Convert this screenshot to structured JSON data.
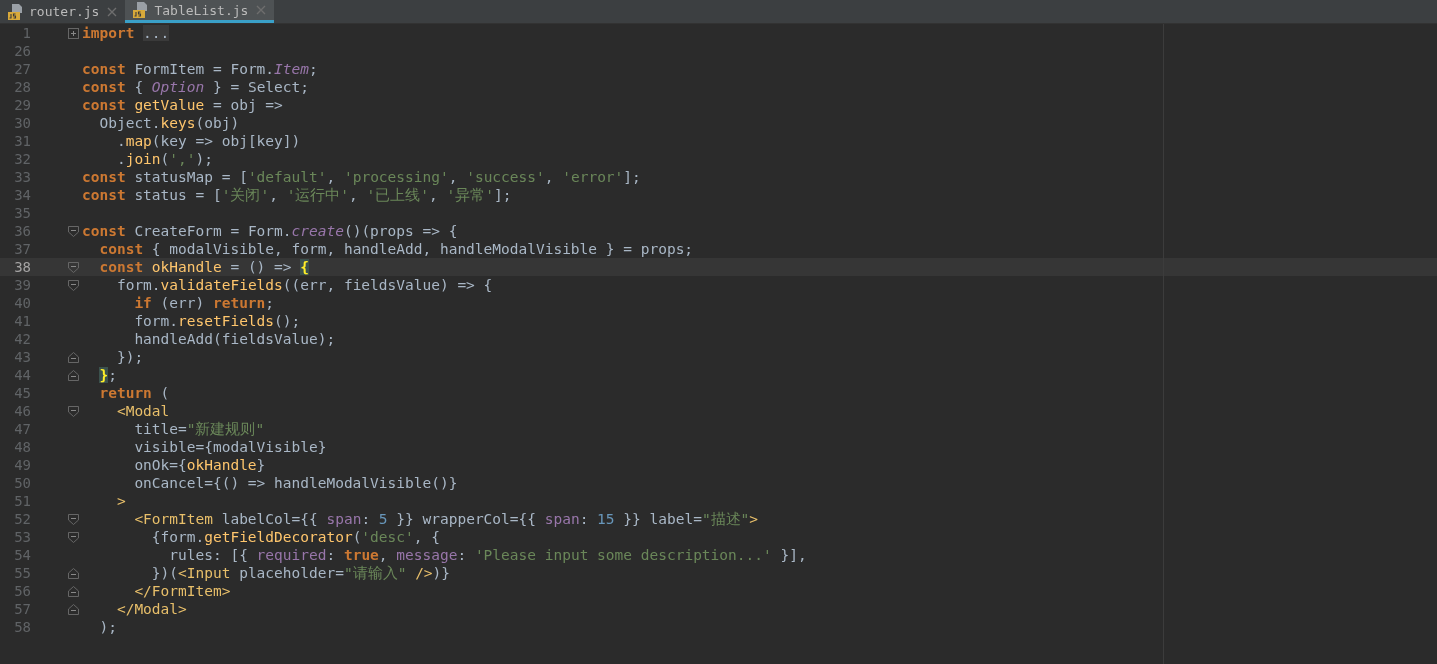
{
  "tabs": [
    {
      "label": "router.js",
      "selected": false
    },
    {
      "label": "TableList.js",
      "selected": true
    }
  ],
  "lines": [
    {
      "number": "1",
      "current": false,
      "kind": "collapsed",
      "tokens": [
        {
          "kind": "keyword",
          "text": "import "
        },
        {
          "kind": "folded",
          "text": "..."
        }
      ]
    },
    {
      "number": "26",
      "current": false,
      "kind": "plain"
    },
    {
      "number": "27",
      "current": false,
      "kind": "plain",
      "tokens": [
        {
          "kind": "keyword",
          "text": "const "
        },
        {
          "kind": "plain",
          "text": "FormItem = Form."
        },
        {
          "kind": "member",
          "text": "Item"
        },
        {
          "kind": "plain",
          "text": ";"
        }
      ]
    },
    {
      "number": "28",
      "current": false,
      "kind": "plain",
      "tokens": [
        {
          "kind": "keyword",
          "text": "const "
        },
        {
          "kind": "plain",
          "text": "{ "
        },
        {
          "kind": "member",
          "text": "Option"
        },
        {
          "kind": "plain",
          "text": " } = Select;"
        }
      ]
    },
    {
      "number": "29",
      "current": false,
      "kind": "plain",
      "tokens": [
        {
          "kind": "keyword",
          "text": "const "
        },
        {
          "kind": "function",
          "text": "getValue"
        },
        {
          "kind": "plain",
          "text": " = obj =>"
        }
      ]
    },
    {
      "number": "30",
      "current": false,
      "kind": "plain",
      "tokens": [
        {
          "kind": "plain",
          "text": "  Object."
        },
        {
          "kind": "function",
          "text": "keys"
        },
        {
          "kind": "plain",
          "text": "(obj)"
        }
      ]
    },
    {
      "number": "31",
      "current": false,
      "kind": "plain",
      "tokens": [
        {
          "kind": "plain",
          "text": "    ."
        },
        {
          "kind": "function",
          "text": "map"
        },
        {
          "kind": "plain",
          "text": "(key => obj[key])"
        }
      ]
    },
    {
      "number": "32",
      "current": false,
      "kind": "plain",
      "tokens": [
        {
          "kind": "plain",
          "text": "    ."
        },
        {
          "kind": "function",
          "text": "join"
        },
        {
          "kind": "plain",
          "text": "("
        },
        {
          "kind": "string",
          "text": "','"
        },
        {
          "kind": "plain",
          "text": ");"
        }
      ]
    },
    {
      "number": "33",
      "current": false,
      "kind": "plain",
      "tokens": [
        {
          "kind": "keyword",
          "text": "const "
        },
        {
          "kind": "plain",
          "text": "statusMap = ["
        },
        {
          "kind": "string",
          "text": "'default'"
        },
        {
          "kind": "plain",
          "text": ", "
        },
        {
          "kind": "string",
          "text": "'processing'"
        },
        {
          "kind": "plain",
          "text": ", "
        },
        {
          "kind": "string",
          "text": "'success'"
        },
        {
          "kind": "plain",
          "text": ", "
        },
        {
          "kind": "string",
          "text": "'error'"
        },
        {
          "kind": "plain",
          "text": "];"
        }
      ]
    },
    {
      "number": "34",
      "current": false,
      "kind": "plain",
      "tokens": [
        {
          "kind": "keyword",
          "text": "const "
        },
        {
          "kind": "plain",
          "text": "status = ["
        },
        {
          "kind": "string",
          "text": "'关闭'"
        },
        {
          "kind": "plain",
          "text": ", "
        },
        {
          "kind": "string",
          "text": "'运行中'"
        },
        {
          "kind": "plain",
          "text": ", "
        },
        {
          "kind": "string",
          "text": "'已上线'"
        },
        {
          "kind": "plain",
          "text": ", "
        },
        {
          "kind": "string",
          "text": "'异常'"
        },
        {
          "kind": "plain",
          "text": "];"
        }
      ]
    },
    {
      "number": "35",
      "current": false,
      "kind": "plain"
    },
    {
      "number": "36",
      "current": false,
      "kind": "opener",
      "tokens": [
        {
          "kind": "keyword",
          "text": "const "
        },
        {
          "kind": "plain",
          "text": "CreateForm = Form."
        },
        {
          "kind": "member",
          "text": "create"
        },
        {
          "kind": "plain",
          "text": "()(props => {"
        }
      ]
    },
    {
      "number": "37",
      "current": false,
      "kind": "plain",
      "tokens": [
        {
          "kind": "keyword",
          "text": "  const "
        },
        {
          "kind": "plain",
          "text": "{ modalVisible, form, handleAdd, handleModalVisible } = props;"
        }
      ]
    },
    {
      "number": "38",
      "current": true,
      "kind": "opener",
      "tokens": [
        {
          "kind": "keyword",
          "text": "  const "
        },
        {
          "kind": "function",
          "text": "okHandle"
        },
        {
          "kind": "plain",
          "text": " = () => "
        },
        {
          "kind": "brace",
          "text": "{"
        }
      ]
    },
    {
      "number": "39",
      "current": false,
      "kind": "opener",
      "tokens": [
        {
          "kind": "plain",
          "text": "    form."
        },
        {
          "kind": "function",
          "text": "validateFields"
        },
        {
          "kind": "plain",
          "text": "((err, fieldsValue) => {"
        }
      ]
    },
    {
      "number": "40",
      "current": false,
      "kind": "plain",
      "tokens": [
        {
          "kind": "keyword",
          "text": "      if"
        },
        {
          "kind": "plain",
          "text": " (err) "
        },
        {
          "kind": "keyword",
          "text": "return"
        },
        {
          "kind": "plain",
          "text": ";"
        }
      ]
    },
    {
      "number": "41",
      "current": false,
      "kind": "plain",
      "tokens": [
        {
          "kind": "plain",
          "text": "      form."
        },
        {
          "kind": "function",
          "text": "resetFields"
        },
        {
          "kind": "plain",
          "text": "();"
        }
      ]
    },
    {
      "number": "42",
      "current": false,
      "kind": "plain",
      "tokens": [
        {
          "kind": "plain",
          "text": "      handleAdd(fieldsValue);"
        }
      ]
    },
    {
      "number": "43",
      "current": false,
      "kind": "closer",
      "tokens": [
        {
          "kind": "plain",
          "text": "    });"
        }
      ]
    },
    {
      "number": "44",
      "current": false,
      "kind": "closer",
      "tokens": [
        {
          "kind": "brace",
          "text": "}"
        },
        {
          "kind": "plain",
          "text": ";"
        }
      ]
    },
    {
      "number": "45",
      "current": false,
      "kind": "plain",
      "tokens": [
        {
          "kind": "keyword",
          "text": "  return"
        },
        {
          "kind": "plain",
          "text": " ("
        }
      ]
    },
    {
      "number": "46",
      "current": false,
      "kind": "opener",
      "tokens": [
        {
          "kind": "tag",
          "text": "    <Modal"
        }
      ]
    },
    {
      "number": "47",
      "current": false,
      "kind": "plain",
      "tokens": [
        {
          "kind": "plain",
          "text": "      title="
        },
        {
          "kind": "string",
          "text": "\"新建规则\""
        }
      ]
    },
    {
      "number": "48",
      "current": false,
      "kind": "plain",
      "tokens": [
        {
          "kind": "plain",
          "text": "      visible={modalVisible}"
        }
      ]
    },
    {
      "number": "49",
      "current": false,
      "kind": "plain",
      "tokens": [
        {
          "kind": "plain",
          "text": "      onOk={"
        },
        {
          "kind": "function",
          "text": "okHandle"
        },
        {
          "kind": "plain",
          "text": "}"
        }
      ]
    },
    {
      "number": "50",
      "current": false,
      "kind": "plain",
      "tokens": [
        {
          "kind": "plain",
          "text": "      onCancel={() => handleModalVisible()}"
        }
      ]
    },
    {
      "number": "51",
      "current": false,
      "kind": "plain",
      "tokens": [
        {
          "kind": "tag",
          "text": "    >"
        }
      ]
    },
    {
      "number": "52",
      "current": false,
      "kind": "opener",
      "tokens": [
        {
          "kind": "tag",
          "text": "      <FormItem"
        },
        {
          "kind": "plain",
          "text": " labelCol={{ "
        },
        {
          "kind": "field",
          "text": "span"
        },
        {
          "kind": "plain",
          "text": ": "
        },
        {
          "kind": "number",
          "text": "5"
        },
        {
          "kind": "plain",
          "text": " }} wrapperCol={{ "
        },
        {
          "kind": "field",
          "text": "span"
        },
        {
          "kind": "plain",
          "text": ": "
        },
        {
          "kind": "number",
          "text": "15"
        },
        {
          "kind": "plain",
          "text": " }} label="
        },
        {
          "kind": "string",
          "text": "\"描述\""
        },
        {
          "kind": "tag",
          "text": ">"
        }
      ]
    },
    {
      "number": "53",
      "current": false,
      "kind": "opener",
      "tokens": [
        {
          "kind": "plain",
          "text": "        {form."
        },
        {
          "kind": "function",
          "text": "getFieldDecorator"
        },
        {
          "kind": "plain",
          "text": "("
        },
        {
          "kind": "string",
          "text": "'desc'"
        },
        {
          "kind": "plain",
          "text": ", {"
        }
      ]
    },
    {
      "number": "54",
      "current": false,
      "kind": "plain",
      "tokens": [
        {
          "kind": "plain",
          "text": "          rules: [{ "
        },
        {
          "kind": "field",
          "text": "required"
        },
        {
          "kind": "plain",
          "text": ": "
        },
        {
          "kind": "keyword",
          "text": "true"
        },
        {
          "kind": "plain",
          "text": ", "
        },
        {
          "kind": "field",
          "text": "message"
        },
        {
          "kind": "plain",
          "text": ": "
        },
        {
          "kind": "string",
          "text": "'Please input some description...'"
        },
        {
          "kind": "plain",
          "text": " }],"
        }
      ]
    },
    {
      "number": "55",
      "current": false,
      "kind": "closer",
      "tokens": [
        {
          "kind": "plain",
          "text": "        })("
        },
        {
          "kind": "tag",
          "text": "<Input"
        },
        {
          "kind": "plain",
          "text": " placeholder="
        },
        {
          "kind": "string",
          "text": "\"请输入\" "
        },
        {
          "kind": "tag",
          "text": "/>"
        },
        {
          "kind": "plain",
          "text": ")}"
        }
      ]
    },
    {
      "number": "56",
      "current": false,
      "kind": "closer",
      "tokens": [
        {
          "kind": "tag",
          "text": "      </FormItem>"
        }
      ]
    },
    {
      "number": "57",
      "current": false,
      "kind": "closer",
      "tokens": [
        {
          "kind": "tag",
          "text": "    </Modal>"
        }
      ]
    },
    {
      "number": "58",
      "current": false,
      "kind": "plain",
      "tokens": [
        {
          "kind": "plain",
          "text": "  );"
        }
      ]
    }
  ]
}
